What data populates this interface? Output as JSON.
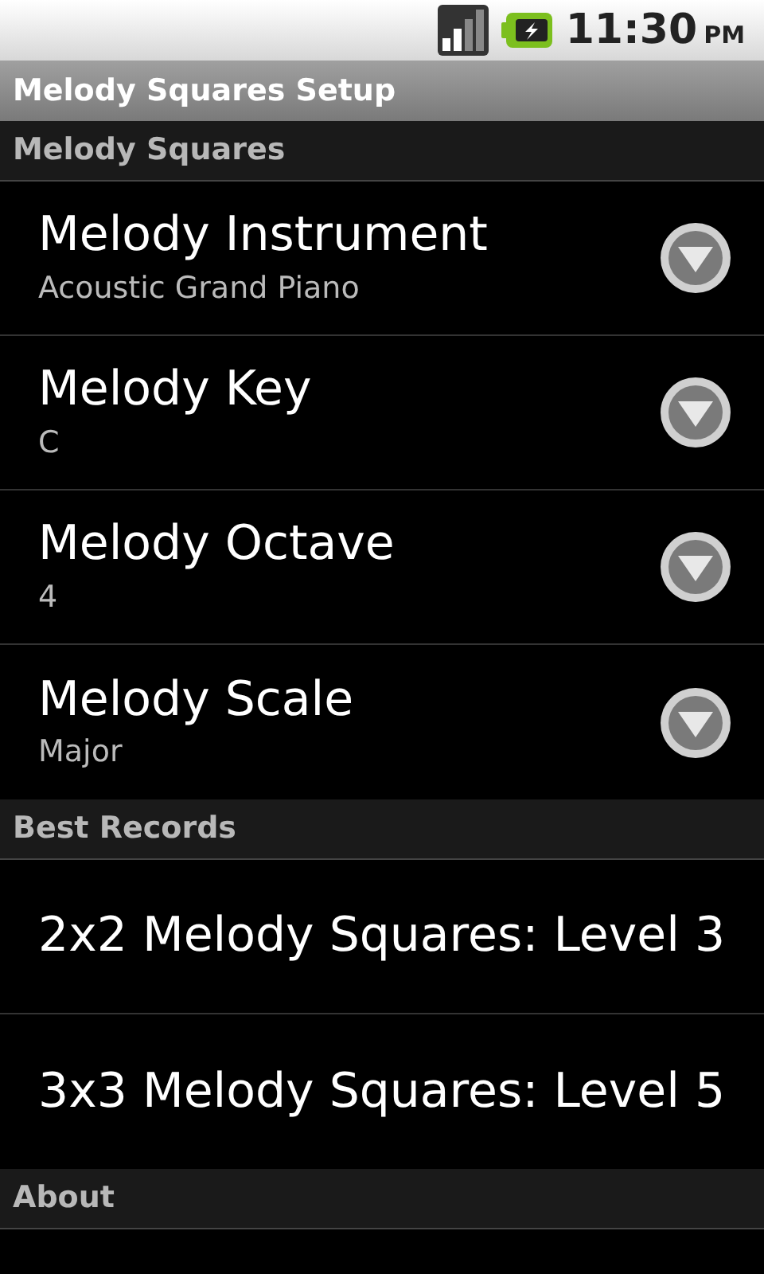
{
  "status_bar": {
    "time": "11:30",
    "ampm": "PM"
  },
  "title": "Melody Squares Setup",
  "sections": [
    {
      "header": "Melody Squares",
      "items": [
        {
          "kind": "list",
          "title": "Melody Instrument",
          "summary": "Acoustic Grand Piano"
        },
        {
          "kind": "list",
          "title": "Melody Key",
          "summary": "C"
        },
        {
          "kind": "list",
          "title": "Melody Octave",
          "summary": "4"
        },
        {
          "kind": "list",
          "title": "Melody Scale",
          "summary": "Major"
        }
      ]
    },
    {
      "header": "Best Records",
      "items": [
        {
          "kind": "plain",
          "title": "2x2 Melody Squares: Level 3"
        },
        {
          "kind": "plain",
          "title": "3x3 Melody Squares: Level 5"
        }
      ]
    },
    {
      "header": "About"
    }
  ]
}
